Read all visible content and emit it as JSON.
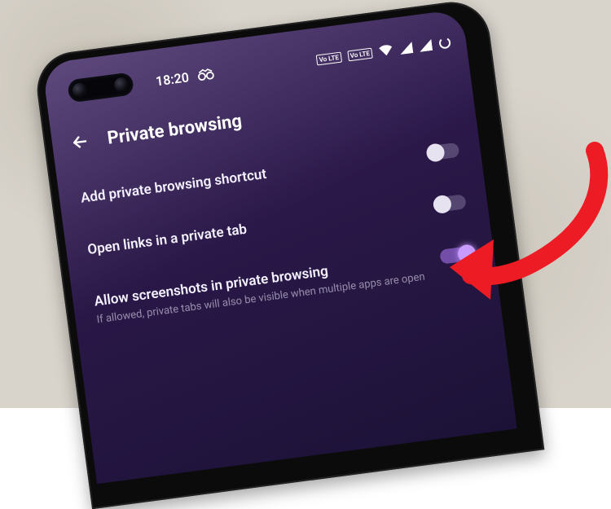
{
  "status_bar": {
    "time": "18:20",
    "incognito_icon": "incognito",
    "sim1_label": "Vo LTE",
    "sim2_label": "Vo LTE"
  },
  "appbar": {
    "title": "Private browsing"
  },
  "settings": {
    "items": [
      {
        "title": "Add private browsing shortcut",
        "subtitle": "",
        "toggle_on": false
      },
      {
        "title": "Open links in a private tab",
        "subtitle": "",
        "toggle_on": false
      },
      {
        "title": "Allow screenshots in private browsing",
        "subtitle": "If allowed, private tabs will also be visible when multiple apps are open",
        "toggle_on": true
      }
    ]
  },
  "colors": {
    "accent": "#c79bff",
    "arrow": "#ed1c24",
    "screen_grad_start": "#3b2160",
    "screen_grad_end": "#1c1237"
  }
}
